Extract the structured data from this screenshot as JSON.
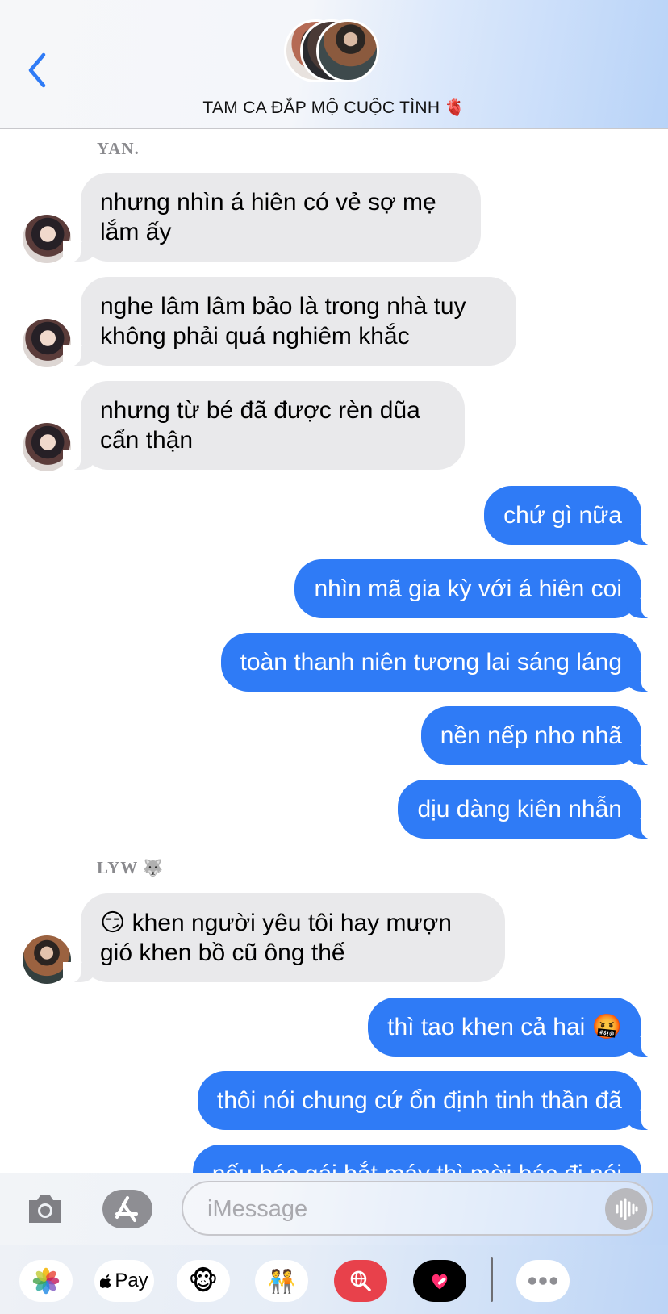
{
  "header": {
    "title": "TAM CA ĐẮP MỘ CUỘC TÌNH",
    "title_emoji": "🫀",
    "accent_color": "#2f7bf6"
  },
  "messages": [
    {
      "type": "sender",
      "name": "YAN."
    },
    {
      "type": "in",
      "text": "nhưng nhìn á hiên có vẻ sợ mẹ lắm ấy"
    },
    {
      "type": "in",
      "text": "nghe lâm lâm bảo là trong nhà tuy không phải quá nghiêm khắc"
    },
    {
      "type": "in",
      "text": "nhưng từ bé đã được rèn dũa cẩn thận"
    },
    {
      "type": "out",
      "text": "chứ gì nữa"
    },
    {
      "type": "out",
      "text": "nhìn mã gia kỳ với á hiên coi"
    },
    {
      "type": "out",
      "text": "toàn thanh niên tương lai sáng láng"
    },
    {
      "type": "out",
      "text": "nền nếp nho nhã"
    },
    {
      "type": "out",
      "text": "dịu dàng kiên nhẫn"
    },
    {
      "type": "sender",
      "name": "LYW",
      "emoji": "🐺"
    },
    {
      "type": "in",
      "text": "😏 khen người yêu tôi hay mượn gió khen bồ cũ ông thế"
    },
    {
      "type": "out",
      "text": "thì tao khen cả hai 🤬"
    },
    {
      "type": "out",
      "text": "thôi nói chung cứ ổn định tinh thần đã"
    },
    {
      "type": "out",
      "text": "nếu bác gái bắt máy thì mời bác đi nói"
    }
  ],
  "input": {
    "placeholder": "iMessage"
  },
  "app_strip": {
    "apple_pay_label": "Pay"
  },
  "colors": {
    "incoming_bubble": "#e9e9eb",
    "outgoing_bubble": "#2f7bf6"
  }
}
